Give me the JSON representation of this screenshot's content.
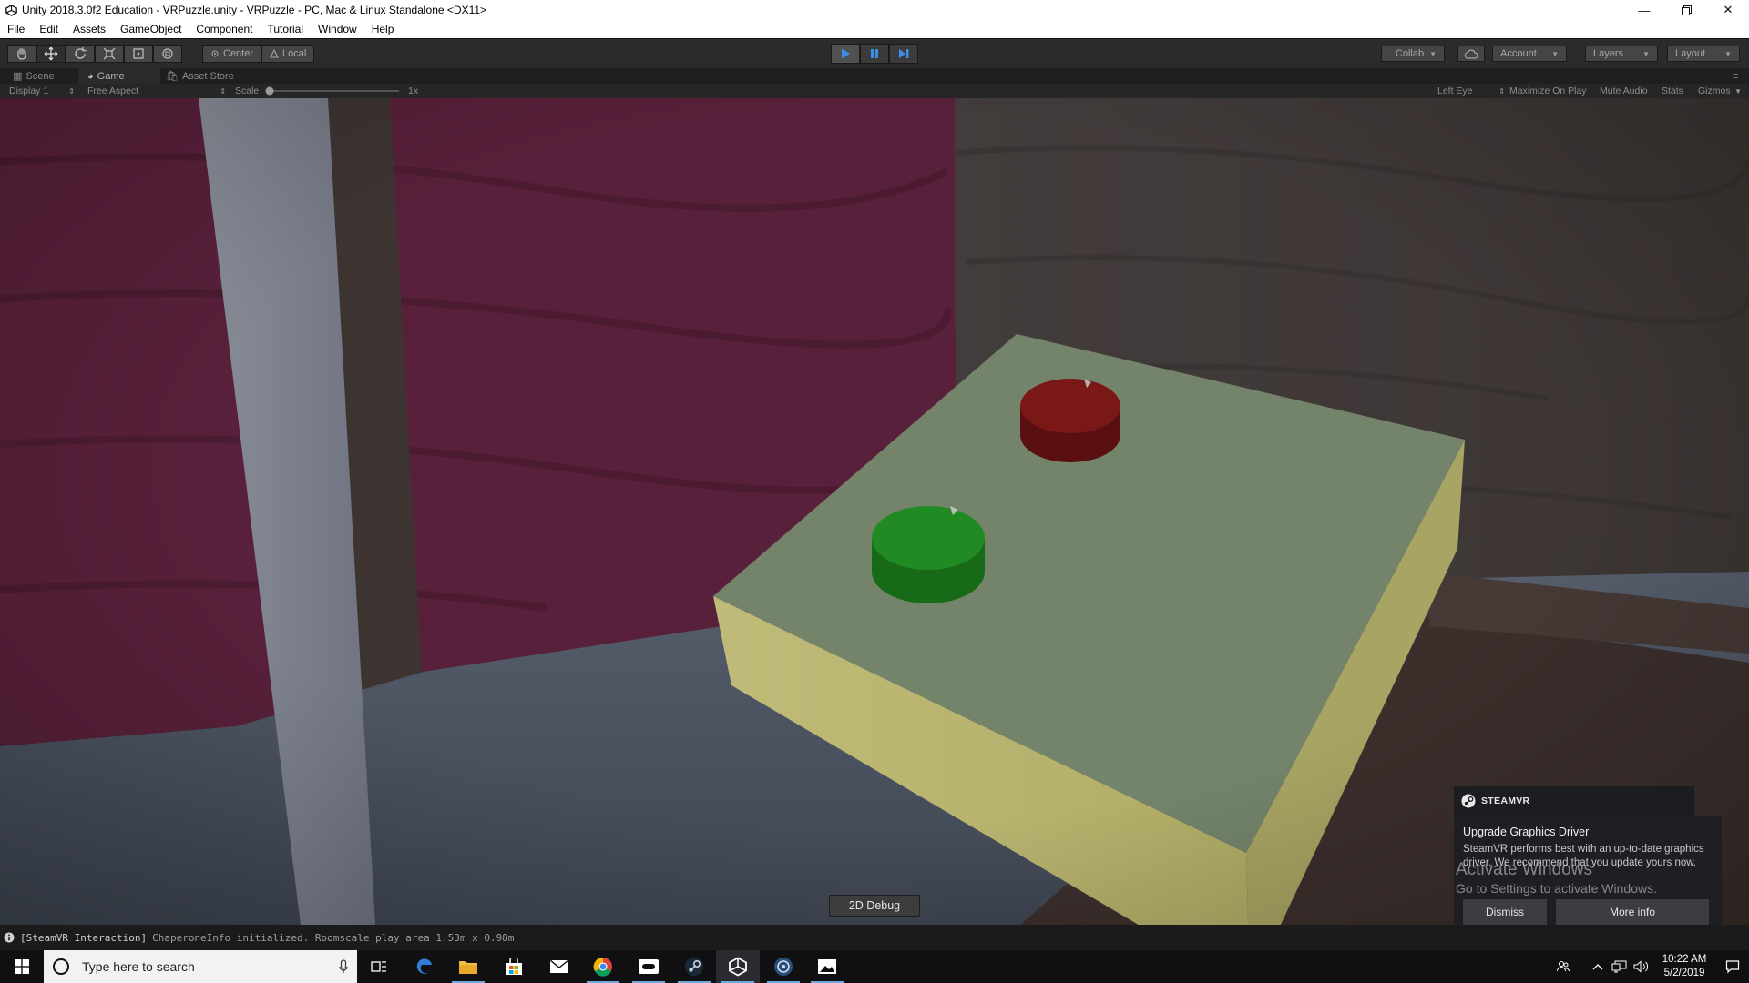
{
  "window": {
    "title": "Unity 2018.3.0f2 Education - VRPuzzle.unity - VRPuzzle - PC, Mac & Linux Standalone <DX11>",
    "controls": [
      "minimize",
      "restore",
      "close"
    ]
  },
  "menu": [
    "File",
    "Edit",
    "Assets",
    "GameObject",
    "Component",
    "Tutorial",
    "Window",
    "Help"
  ],
  "toolbar": {
    "tools": [
      "hand-tool",
      "move-tool",
      "rotate-tool",
      "scale-tool",
      "rect-tool",
      "transform-tool"
    ],
    "active_tool": "move-tool",
    "pivot_label": "Center",
    "space_label": "Local",
    "playmode": {
      "play_active": true,
      "pause_active": false
    },
    "collab_label": "Collab",
    "account_label": "Account",
    "layers_label": "Layers",
    "layout_label": "Layout"
  },
  "tabs": [
    {
      "label": "Scene",
      "active": false
    },
    {
      "label": "Game",
      "active": true
    },
    {
      "label": "Asset Store",
      "active": false
    }
  ],
  "game_bar": {
    "display": "Display 1",
    "aspect": "Free Aspect",
    "scale_label": "Scale",
    "scale_value": "1x",
    "eye": "Left Eye",
    "maximize": "Maximize On Play",
    "mute": "Mute Audio",
    "stats": "Stats",
    "gizmos": "Gizmos"
  },
  "scene": {
    "debug_button": "2D Debug",
    "colors": {
      "wall": "#5a2037",
      "floor": "#505866",
      "table_top": "#72836a",
      "table_side": "#b9b570",
      "red_button": "#6a1414",
      "green_button": "#1f7a1f"
    }
  },
  "steamvr_notification": {
    "brand": "STEAMVR",
    "title": "Upgrade Graphics Driver",
    "message": "SteamVR performs best with an up-to-date graphics driver. We recommend that you update yours now.",
    "dismiss_label": "Dismiss",
    "more_label": "More info"
  },
  "watermark": {
    "line1": "Activate Windows",
    "line2": "Go to Settings to activate Windows."
  },
  "console": {
    "tag": "[SteamVR Interaction]",
    "message": "ChaperoneInfo initialized. Roomscale play area 1.53m x 0.98m"
  },
  "taskbar": {
    "search_placeholder": "Type here to search",
    "apps": [
      "task-view",
      "edge",
      "file-explorer",
      "store",
      "mail",
      "chrome",
      "oculus",
      "steam",
      "unity",
      "steamvr",
      "photos"
    ],
    "time": "10:22 AM",
    "date": "5/2/2019"
  }
}
